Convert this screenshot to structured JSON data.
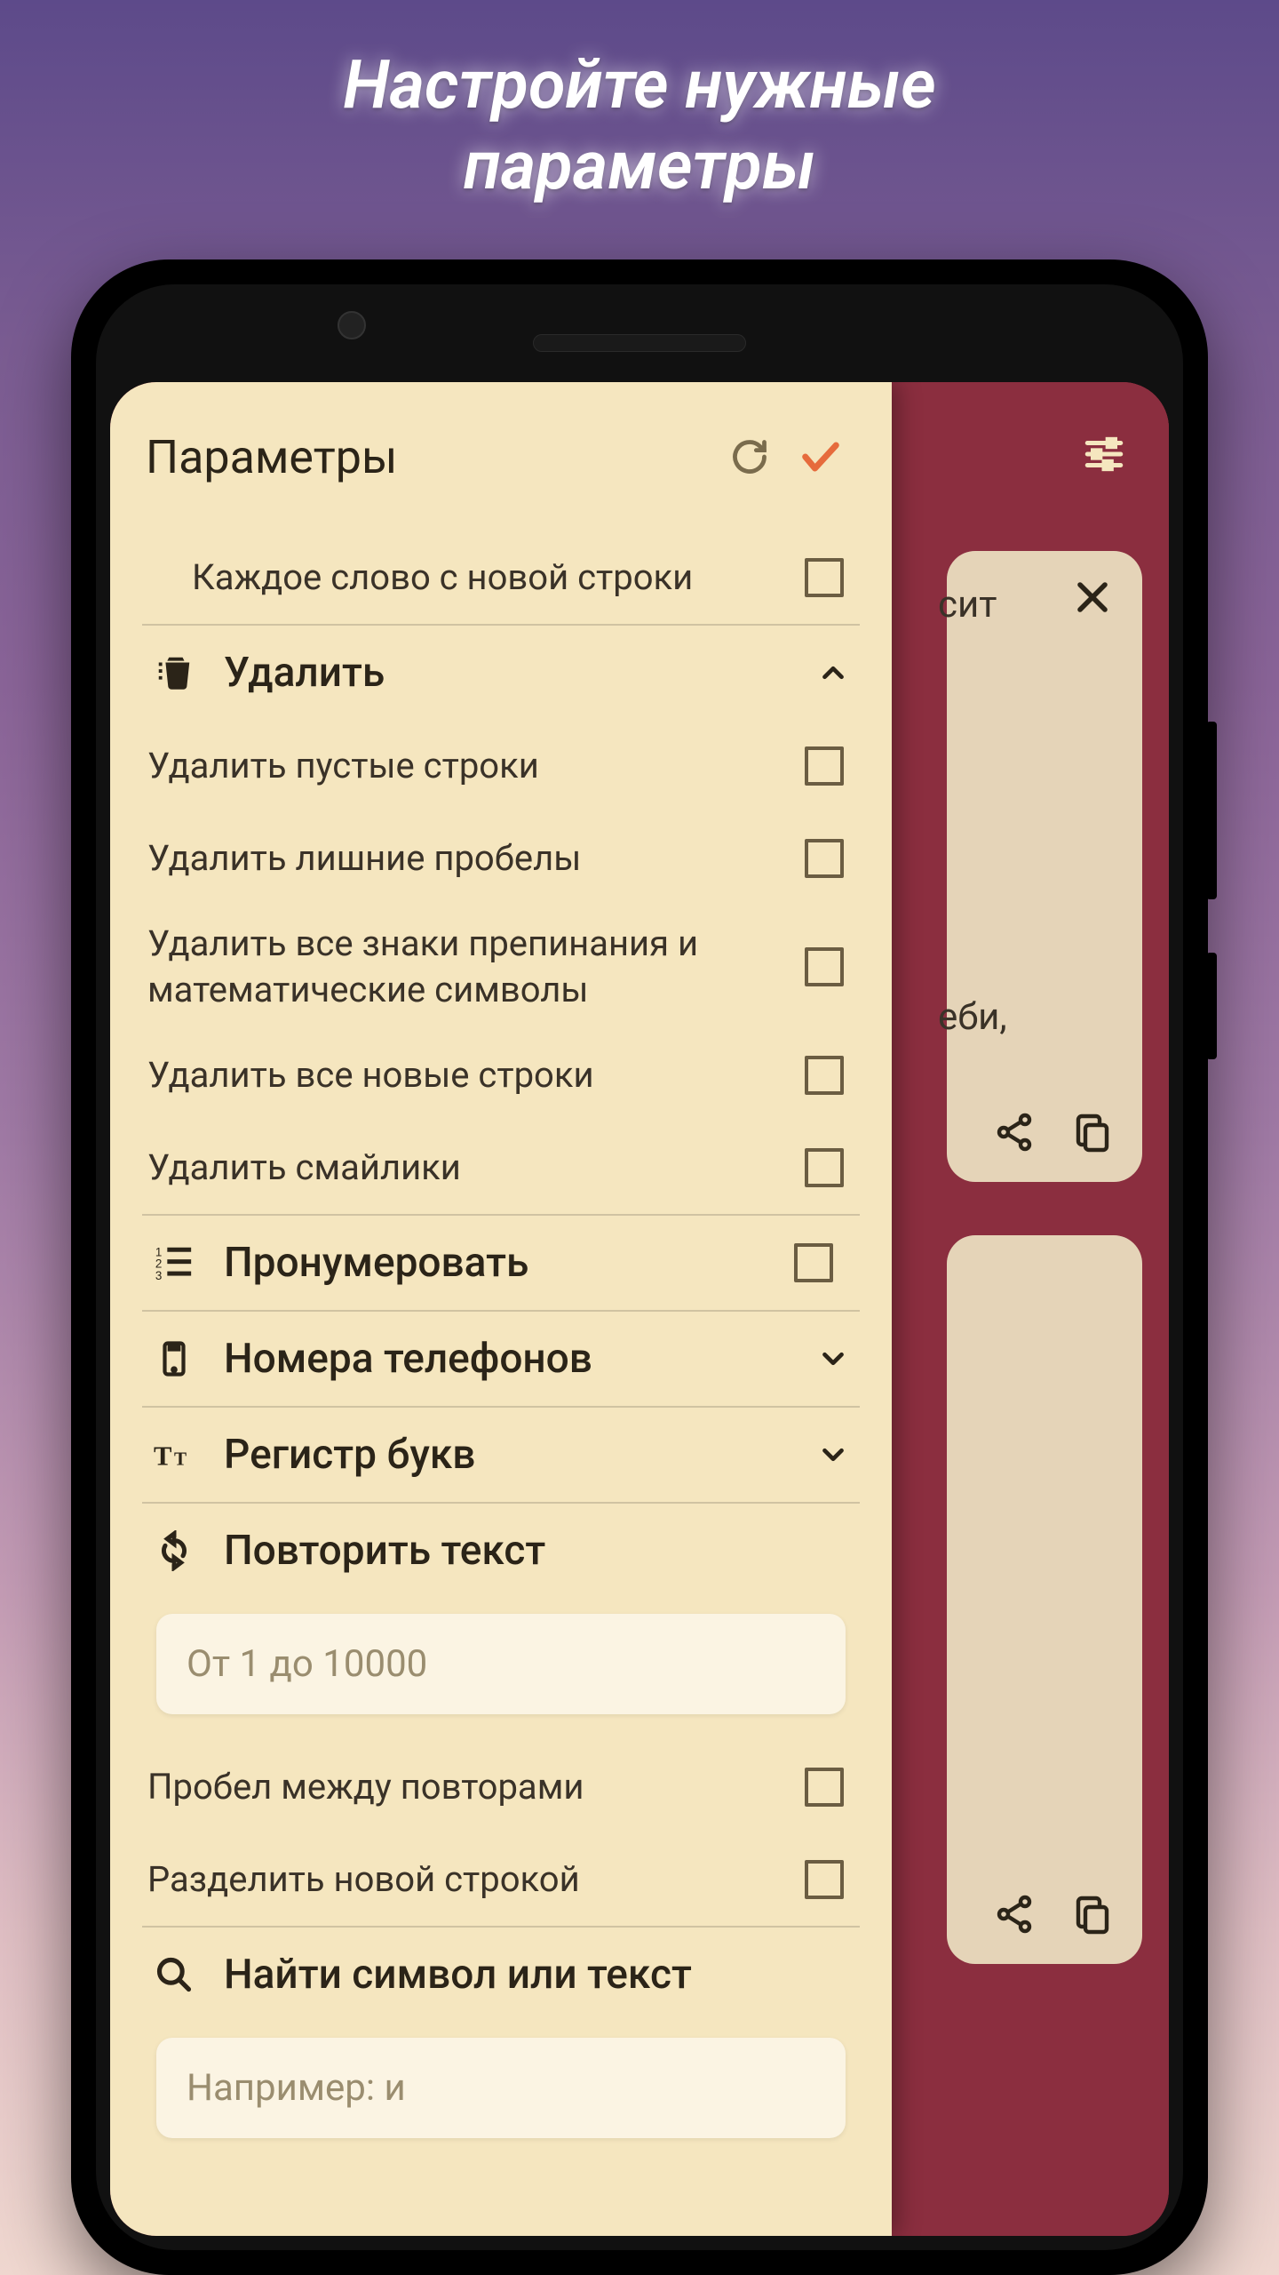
{
  "promo": {
    "line1": "Настройте нужные",
    "line2": "параметры"
  },
  "background_app": {
    "partial_text_1": "сит",
    "partial_text_2": "еби,"
  },
  "panel": {
    "title": "Параметры",
    "each_word_new_line": "Каждое слово с новой строки",
    "delete": {
      "title": "Удалить",
      "empty_lines": "Удалить пустые строки",
      "extra_spaces": "Удалить лишние пробелы",
      "punctuation": "Удалить все знаки препинания и математические символы",
      "new_lines": "Удалить все новые строки",
      "emoji": "Удалить смайлики"
    },
    "enumerate": "Пронумеровать",
    "phone_numbers": "Номера телефонов",
    "letter_case": "Регистр букв",
    "repeat": {
      "title": "Повторить текст",
      "placeholder": "От 1 до 10000",
      "space_between": "Пробел между повторами",
      "split_newline": "Разделить новой строкой"
    },
    "find": {
      "title": "Найти символ или текст",
      "placeholder": "Например: и"
    }
  },
  "colors": {
    "accent": "#e66b3c",
    "panel_bg": "#f5e6bf",
    "app_bg": "#8b2e3f",
    "card_bg": "#e5d4b8",
    "text_dark": "#2b2418"
  }
}
